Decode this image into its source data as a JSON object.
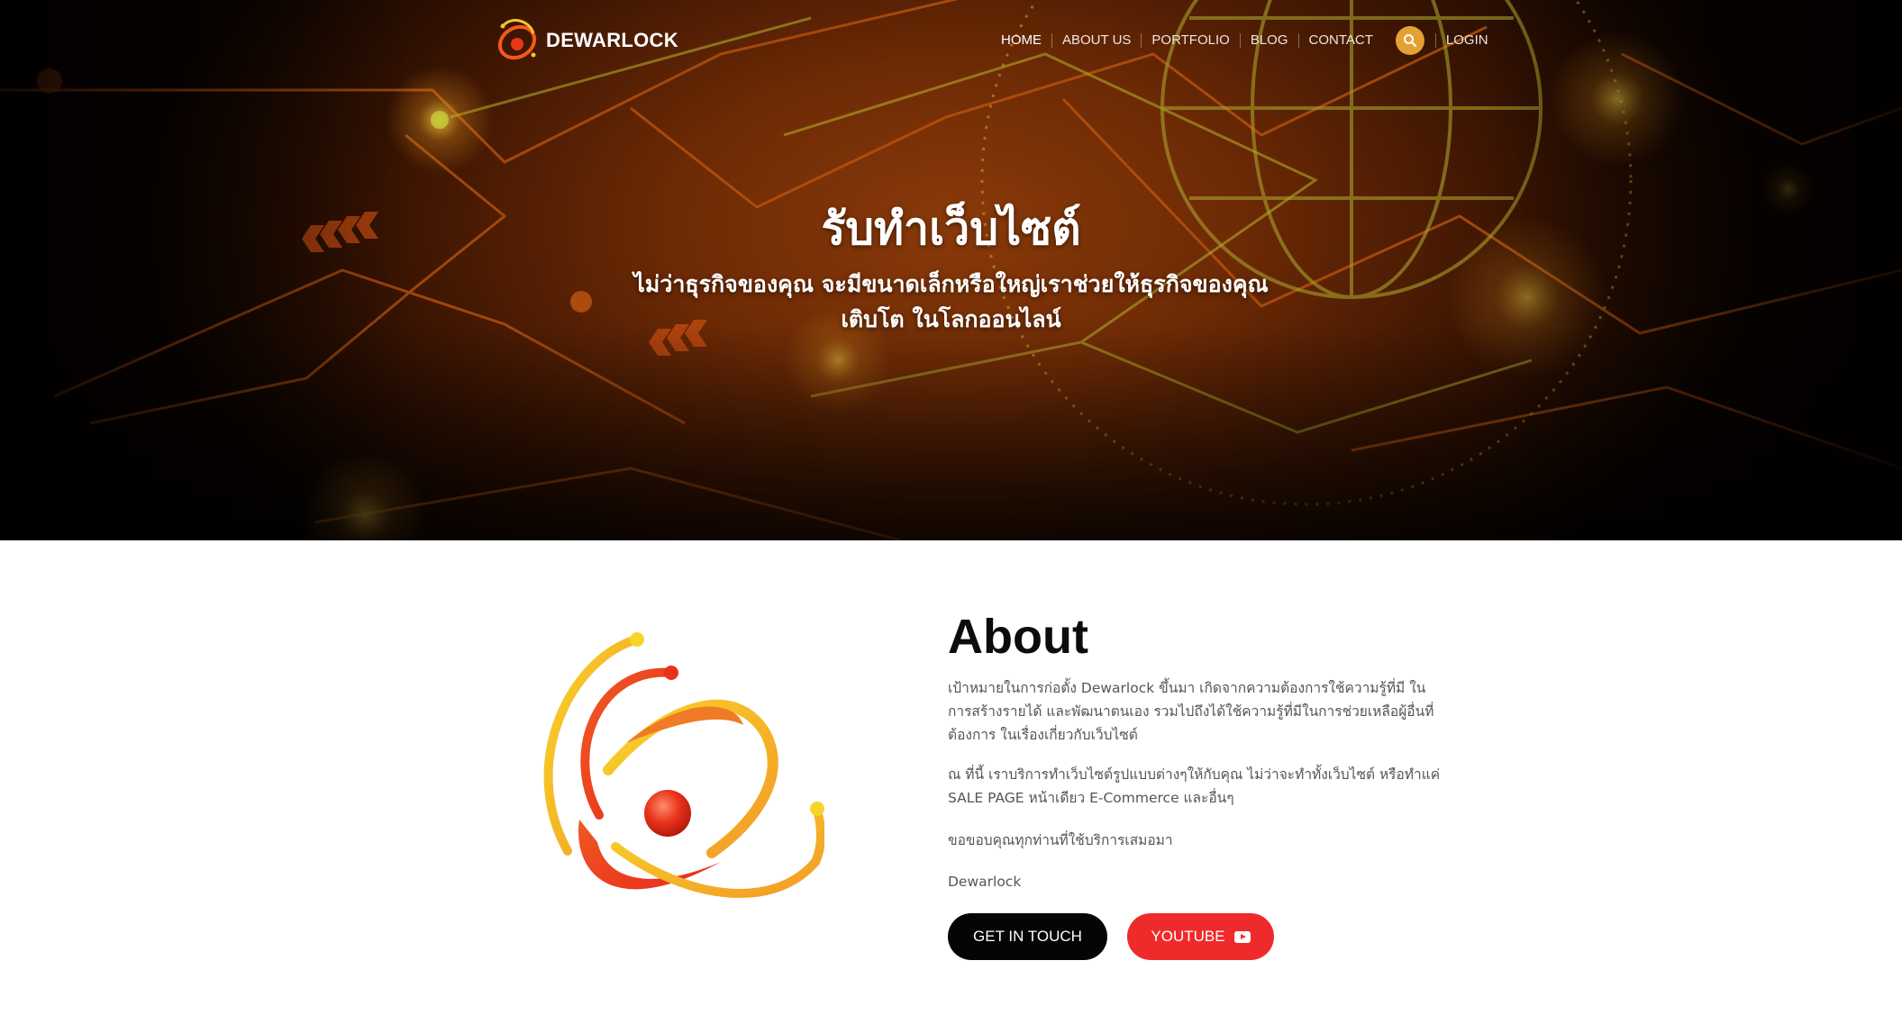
{
  "brand": {
    "name": "DEWARLOCK",
    "accent": "#e3a133",
    "primary_red": "#ef2a2a"
  },
  "nav": {
    "items": [
      {
        "label": "HOME",
        "active": true
      },
      {
        "label": "ABOUT US"
      },
      {
        "label": "PORTFOLIO"
      },
      {
        "label": "BLOG"
      },
      {
        "label": "CONTACT"
      }
    ],
    "search_icon": "search-icon",
    "login": "LOGIN"
  },
  "hero": {
    "title": "รับทำเว็บไซต์",
    "subtitle_line1": "ไม่ว่าธุรกิจของคุณ จะมีขนาดเล็กหรือใหญ่เราช่วยให้ธุรกิจของคุณ",
    "subtitle_line2": "เติบโต ในโลกออนไลน์"
  },
  "about": {
    "title": "About",
    "paragraph1": "เป้าหมายในการก่อตั้ง Dewarlock ขึ้นมา เกิดจากความต้องการใช้ความรู้ที่มี ในการสร้างรายได้ และพัฒนาตนเอง รวมไปถึงได้ใช้ความรู้ที่มีในการช่วยเหลือผู้อื่นที่ต้องการ ในเรื่องเกี่ยวกับเว็บไซต์",
    "paragraph2": "ณ ที่นี้ เราบริการทำเว็บไซต์รูปแบบต่างๆให้กับคุณ ไม่ว่าจะทำทั้งเว็บไซต์ หรือทำแค่ SALE PAGE หน้าเดียว E-Commerce และอื่นๆ",
    "paragraph3": "ขอขอบคุณทุกท่านที่ใช้บริการเสมอมา",
    "signature": "Dewarlock",
    "btn_contact": "GET IN TOUCH",
    "btn_youtube": "YOUTUBE",
    "youtube_icon": "youtube-icon"
  }
}
